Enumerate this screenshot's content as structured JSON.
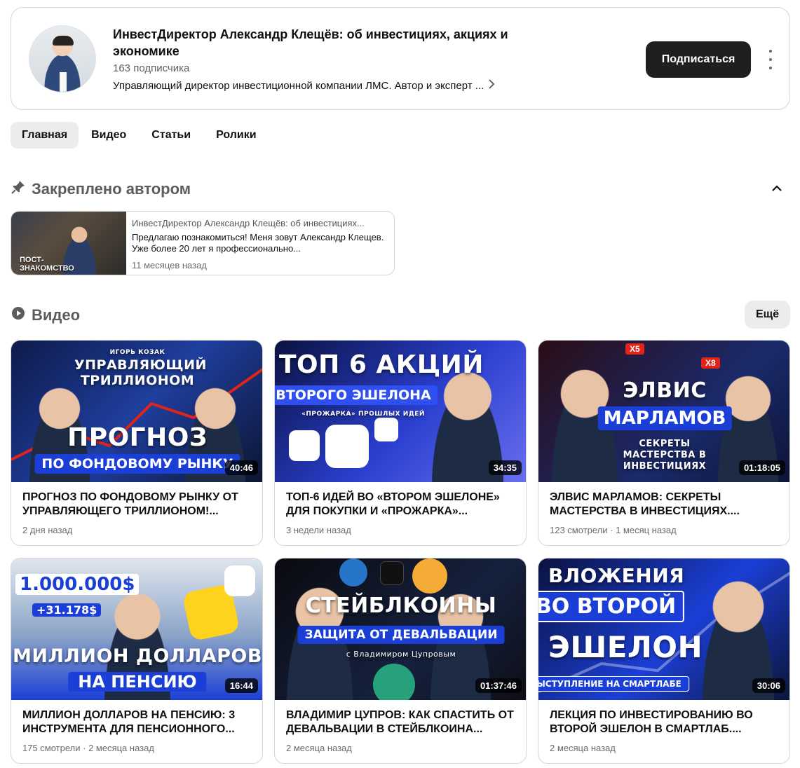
{
  "channel": {
    "title": "ИнвестДиректор Александр Клещёв: об инвестициях, акциях и экономике",
    "subscribers": "163 подписчика",
    "description": "Управляющий директор инвестиционной компании ЛМС. Автор и эксперт ...",
    "subscribe_label": "Подписаться"
  },
  "tabs": [
    {
      "label": "Главная"
    },
    {
      "label": "Видео"
    },
    {
      "label": "Статьи"
    },
    {
      "label": "Ролики"
    }
  ],
  "pinned": {
    "section_title": "Закреплено автором",
    "author": "ИнвестДиректор Александр Клещёв: об инвестициях...",
    "text": "Предлагаю познакомиться! Меня зовут Александр Клещев. Уже более 20 лет я профессионально...",
    "time": "11 месяцев назад",
    "thumb_caption_1": "ПОСТ-",
    "thumb_caption_2": "ЗНАКОМСТВО"
  },
  "videos_section": {
    "title": "Видео",
    "more_label": "Ещё"
  },
  "videos": [
    {
      "title": "ПРОГНОЗ ПО ФОНДОВОМУ РЫНКУ ОТ УПРАВЛЯЮЩЕГО ТРИЛЛИОНОМ!...",
      "meta": "2 дня назад",
      "duration": "40:46",
      "thumb_small": "ИГОРЬ КОЗАК",
      "thumb_top": "УПРАВЛЯЮЩИЙ ТРИЛЛИОНОМ",
      "thumb_big": "ПРОГНОЗ",
      "thumb_band": "ПО ФОНДОВОМУ РЫНКУ"
    },
    {
      "title": "ТОП-6 ИДЕЙ ВО «ВТОРОМ ЭШЕЛОНЕ» ДЛЯ ПОКУПКИ И «ПРОЖАРКА»...",
      "meta": "3 недели назад",
      "duration": "34:35",
      "thumb_big": "ТОП 6 АКЦИЙ",
      "thumb_band": "ВТОРОГО ЭШЕЛОНА",
      "thumb_small": "«ПРОЖАРКА» ПРОШЛЫХ ИДЕЙ"
    },
    {
      "title": "ЭЛВИС МАРЛАМОВ: СЕКРЕТЫ МАСТЕРСТВА В ИНВЕСТИЦИЯХ....",
      "meta": "123 смотрели · 1 месяц назад",
      "duration": "01:18:05",
      "thumb_big": "ЭЛВИС",
      "thumb_band": "МАРЛАМОВ",
      "thumb_small": "СЕКРЕТЫ МАСТЕРСТВА В ИНВЕСТИЦИЯХ",
      "badge_1": "X5",
      "badge_2": "X8"
    },
    {
      "title": "МИЛЛИОН ДОЛЛАРОВ НА ПЕНСИЮ: 3 ИНСТРУМЕНТА ДЛЯ ПЕНСИОННОГО...",
      "meta": "175 смотрели · 2 месяца назад",
      "duration": "16:44",
      "thumb_top": "1.000.000$",
      "thumb_small": "+31.178$",
      "thumb_big": "МИЛЛИОН ДОЛЛАРОВ",
      "thumb_band": "НА ПЕНСИЮ"
    },
    {
      "title": "ВЛАДИМИР ЦУПРОВ: КАК СПАСТИТЬ ОТ ДЕВАЛЬВАЦИИ В СТЕЙБЛКОИНА...",
      "meta": "2 месяца назад",
      "duration": "01:37:46",
      "thumb_big": "СТЕЙБЛКОИНЫ",
      "thumb_band": "ЗАЩИТА ОТ ДЕВАЛЬВАЦИИ",
      "thumb_small": "с Владимиром Цупровым"
    },
    {
      "title": "ЛЕКЦИЯ ПО ИНВЕСТИРОВАНИЮ ВО ВТОРОЙ ЭШЕЛОН В СМАРТЛАБ....",
      "meta": "2 месяца назад",
      "duration": "30:06",
      "thumb_top": "ВЛОЖЕНИЯ",
      "thumb_band": "ВО ВТОРОЙ",
      "thumb_big": "ЭШЕЛОН",
      "thumb_small": "ВЫСТУПЛЕНИЕ НА СМАРТЛАБЕ"
    }
  ],
  "colors": {
    "subscribe_bg": "#1f1f1f",
    "tab_active_bg": "#ececec",
    "thumb_blue": "#1b3fd6",
    "thumb_red": "#e2231a"
  }
}
